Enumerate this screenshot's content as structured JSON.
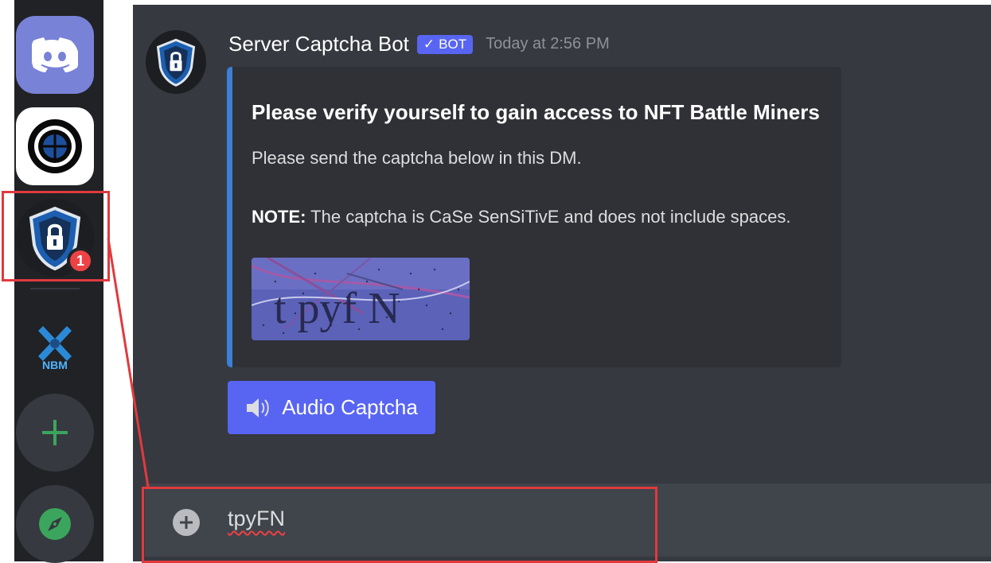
{
  "servers": [
    {
      "name": "discord-home",
      "icon": "discord-logo"
    },
    {
      "name": "target-server",
      "icon": "target-icon"
    },
    {
      "name": "captcha-server",
      "icon": "shield-lock-icon",
      "badge": "1"
    },
    {
      "name": "nbm-server",
      "icon": "nbm-logo",
      "label": "NBM"
    },
    {
      "name": "add-server",
      "icon": "plus-icon"
    },
    {
      "name": "explore",
      "icon": "compass-icon"
    }
  ],
  "message": {
    "author": "Server Captcha Bot",
    "bot_tag": "BOT",
    "bot_check": "✓",
    "timestamp": "Today at 2:56 PM"
  },
  "embed": {
    "title": "Please verify yourself to gain access to NFT Battle Miners",
    "description": "Please send the captcha below in this DM.",
    "note_label": "NOTE:",
    "note_text": " The captcha is CaSe SenSiTivE and does not include spaces.",
    "captcha_text": "t pyf N"
  },
  "audio_button": {
    "label": "Audio Captcha"
  },
  "input": {
    "value": "tpyFN"
  },
  "colors": {
    "accent": "#5865f2",
    "embed_border": "#3b7fd6",
    "highlight": "#e03a3e",
    "badge": "#ed4245"
  }
}
